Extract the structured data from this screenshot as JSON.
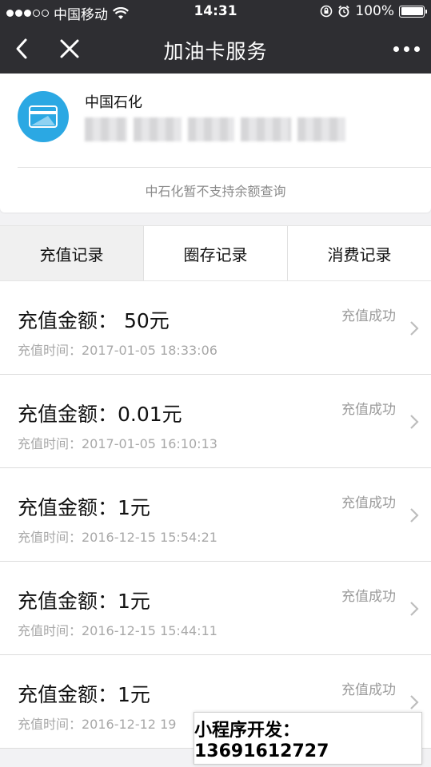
{
  "status_bar": {
    "carrier": "中国移动",
    "time": "14:31",
    "battery": "100%"
  },
  "nav": {
    "title": "加油卡服务"
  },
  "card": {
    "name": "中国石化",
    "note": "中石化暂不支持余额查询"
  },
  "tabs": [
    {
      "label": "充值记录"
    },
    {
      "label": "圈存记录"
    },
    {
      "label": "消费记录"
    }
  ],
  "records": [
    {
      "amount": "充值金额： 50元",
      "time": "充值时间：2017-01-05 18:33:06",
      "status": "充值成功"
    },
    {
      "amount": "充值金额：0.01元",
      "time": "充值时间：2017-01-05 16:10:13",
      "status": "充值成功"
    },
    {
      "amount": "充值金额：1元",
      "time": "充值时间：2016-12-15 15:54:21",
      "status": "充值成功"
    },
    {
      "amount": "充值金额：1元",
      "time": "充值时间：2016-12-15 15:44:11",
      "status": "充值成功"
    },
    {
      "amount": "充值金额：1元",
      "time": "充值时间：2016-12-12 19",
      "status": "充值成功"
    }
  ],
  "watermark": {
    "text": "小程序开发：13691612727"
  },
  "colors": {
    "nav_background": "#2e2e32",
    "card_icon": "#2ba8e3",
    "status_text": "#9b9b9b"
  }
}
